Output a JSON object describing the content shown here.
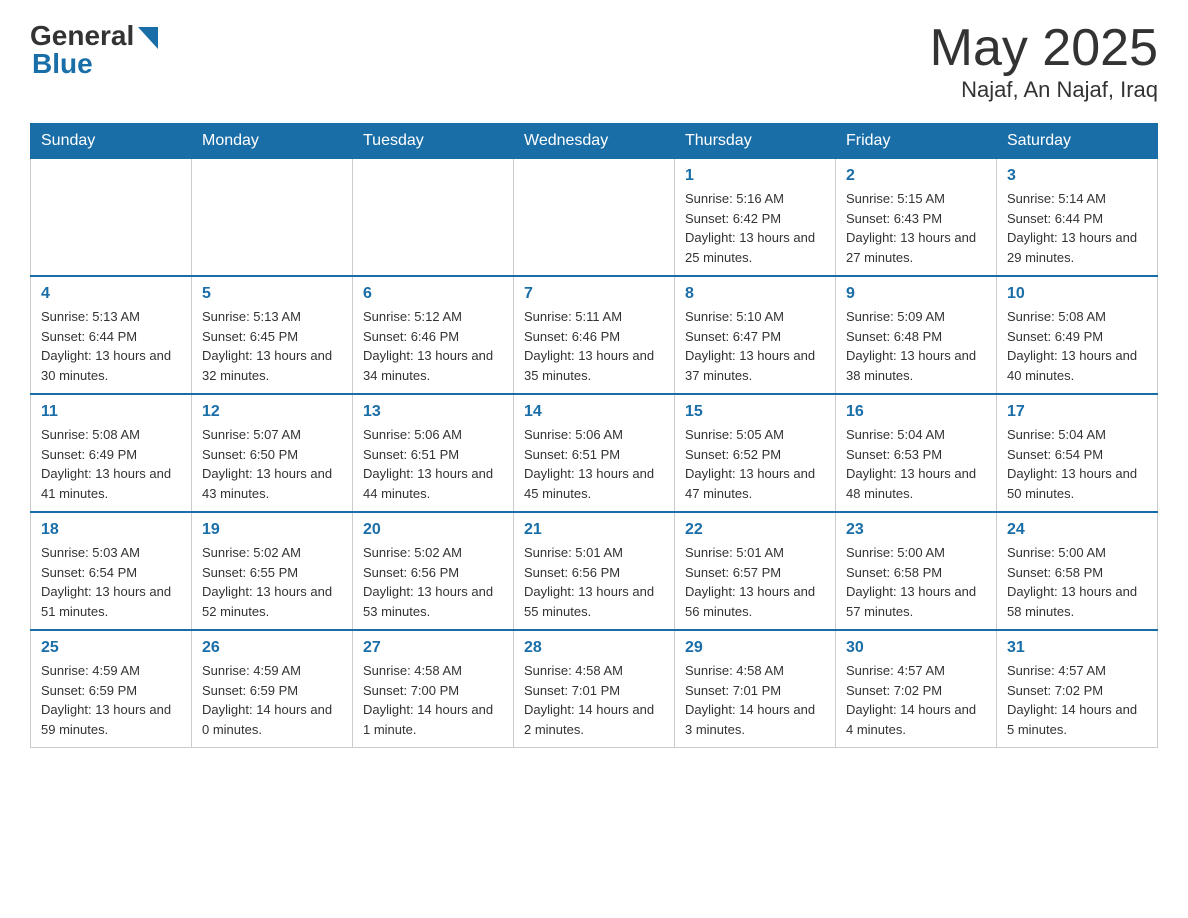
{
  "header": {
    "logo_general": "General",
    "logo_blue": "Blue",
    "month_title": "May 2025",
    "location": "Najaf, An Najaf, Iraq"
  },
  "weekdays": [
    "Sunday",
    "Monday",
    "Tuesday",
    "Wednesday",
    "Thursday",
    "Friday",
    "Saturday"
  ],
  "weeks": [
    [
      {
        "day": "",
        "info": ""
      },
      {
        "day": "",
        "info": ""
      },
      {
        "day": "",
        "info": ""
      },
      {
        "day": "",
        "info": ""
      },
      {
        "day": "1",
        "info": "Sunrise: 5:16 AM\nSunset: 6:42 PM\nDaylight: 13 hours and 25 minutes."
      },
      {
        "day": "2",
        "info": "Sunrise: 5:15 AM\nSunset: 6:43 PM\nDaylight: 13 hours and 27 minutes."
      },
      {
        "day": "3",
        "info": "Sunrise: 5:14 AM\nSunset: 6:44 PM\nDaylight: 13 hours and 29 minutes."
      }
    ],
    [
      {
        "day": "4",
        "info": "Sunrise: 5:13 AM\nSunset: 6:44 PM\nDaylight: 13 hours and 30 minutes."
      },
      {
        "day": "5",
        "info": "Sunrise: 5:13 AM\nSunset: 6:45 PM\nDaylight: 13 hours and 32 minutes."
      },
      {
        "day": "6",
        "info": "Sunrise: 5:12 AM\nSunset: 6:46 PM\nDaylight: 13 hours and 34 minutes."
      },
      {
        "day": "7",
        "info": "Sunrise: 5:11 AM\nSunset: 6:46 PM\nDaylight: 13 hours and 35 minutes."
      },
      {
        "day": "8",
        "info": "Sunrise: 5:10 AM\nSunset: 6:47 PM\nDaylight: 13 hours and 37 minutes."
      },
      {
        "day": "9",
        "info": "Sunrise: 5:09 AM\nSunset: 6:48 PM\nDaylight: 13 hours and 38 minutes."
      },
      {
        "day": "10",
        "info": "Sunrise: 5:08 AM\nSunset: 6:49 PM\nDaylight: 13 hours and 40 minutes."
      }
    ],
    [
      {
        "day": "11",
        "info": "Sunrise: 5:08 AM\nSunset: 6:49 PM\nDaylight: 13 hours and 41 minutes."
      },
      {
        "day": "12",
        "info": "Sunrise: 5:07 AM\nSunset: 6:50 PM\nDaylight: 13 hours and 43 minutes."
      },
      {
        "day": "13",
        "info": "Sunrise: 5:06 AM\nSunset: 6:51 PM\nDaylight: 13 hours and 44 minutes."
      },
      {
        "day": "14",
        "info": "Sunrise: 5:06 AM\nSunset: 6:51 PM\nDaylight: 13 hours and 45 minutes."
      },
      {
        "day": "15",
        "info": "Sunrise: 5:05 AM\nSunset: 6:52 PM\nDaylight: 13 hours and 47 minutes."
      },
      {
        "day": "16",
        "info": "Sunrise: 5:04 AM\nSunset: 6:53 PM\nDaylight: 13 hours and 48 minutes."
      },
      {
        "day": "17",
        "info": "Sunrise: 5:04 AM\nSunset: 6:54 PM\nDaylight: 13 hours and 50 minutes."
      }
    ],
    [
      {
        "day": "18",
        "info": "Sunrise: 5:03 AM\nSunset: 6:54 PM\nDaylight: 13 hours and 51 minutes."
      },
      {
        "day": "19",
        "info": "Sunrise: 5:02 AM\nSunset: 6:55 PM\nDaylight: 13 hours and 52 minutes."
      },
      {
        "day": "20",
        "info": "Sunrise: 5:02 AM\nSunset: 6:56 PM\nDaylight: 13 hours and 53 minutes."
      },
      {
        "day": "21",
        "info": "Sunrise: 5:01 AM\nSunset: 6:56 PM\nDaylight: 13 hours and 55 minutes."
      },
      {
        "day": "22",
        "info": "Sunrise: 5:01 AM\nSunset: 6:57 PM\nDaylight: 13 hours and 56 minutes."
      },
      {
        "day": "23",
        "info": "Sunrise: 5:00 AM\nSunset: 6:58 PM\nDaylight: 13 hours and 57 minutes."
      },
      {
        "day": "24",
        "info": "Sunrise: 5:00 AM\nSunset: 6:58 PM\nDaylight: 13 hours and 58 minutes."
      }
    ],
    [
      {
        "day": "25",
        "info": "Sunrise: 4:59 AM\nSunset: 6:59 PM\nDaylight: 13 hours and 59 minutes."
      },
      {
        "day": "26",
        "info": "Sunrise: 4:59 AM\nSunset: 6:59 PM\nDaylight: 14 hours and 0 minutes."
      },
      {
        "day": "27",
        "info": "Sunrise: 4:58 AM\nSunset: 7:00 PM\nDaylight: 14 hours and 1 minute."
      },
      {
        "day": "28",
        "info": "Sunrise: 4:58 AM\nSunset: 7:01 PM\nDaylight: 14 hours and 2 minutes."
      },
      {
        "day": "29",
        "info": "Sunrise: 4:58 AM\nSunset: 7:01 PM\nDaylight: 14 hours and 3 minutes."
      },
      {
        "day": "30",
        "info": "Sunrise: 4:57 AM\nSunset: 7:02 PM\nDaylight: 14 hours and 4 minutes."
      },
      {
        "day": "31",
        "info": "Sunrise: 4:57 AM\nSunset: 7:02 PM\nDaylight: 14 hours and 5 minutes."
      }
    ]
  ]
}
